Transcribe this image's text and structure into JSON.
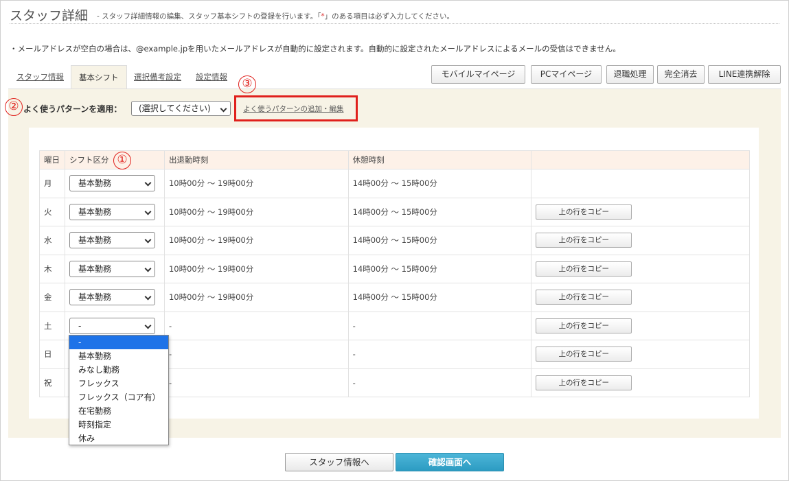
{
  "header": {
    "title": "スタッフ詳細",
    "subtitle_pre": "- スタッフ詳細情報の編集、スタッフ基本シフトの登録を行います。「",
    "subtitle_req": "*",
    "subtitle_post": "」のある項目は必ず入力してください。"
  },
  "notice": "・メールアドレスが空白の場合は、@example.jpを用いたメールアドレスが自動的に設定されます。自動的に設定されたメールアドレスによるメールの受信はできません。",
  "tabs": [
    {
      "label": "スタッフ情報",
      "active": false
    },
    {
      "label": "基本シフト",
      "active": true
    },
    {
      "label": "選択備考設定",
      "active": false
    },
    {
      "label": "設定情報",
      "active": false
    }
  ],
  "top_buttons": [
    "モバイルマイページ",
    "PCマイページ",
    "退職処理",
    "完全消去",
    "LINE連携解除"
  ],
  "pattern": {
    "label": "よく使うパターンを適用：",
    "selected": "(選択してください)",
    "edit_link": "よく使うパターンの追加・編集"
  },
  "markers": [
    "①",
    "②",
    "③"
  ],
  "table": {
    "headers": [
      "曜日",
      "シフト区分",
      "出退勤時刻",
      "休憩時刻",
      ""
    ],
    "rows": [
      {
        "day": "月",
        "shift": "基本勤務",
        "work": "10時00分 ～ 19時00分",
        "break": "14時00分 ～ 15時00分",
        "copy": ""
      },
      {
        "day": "火",
        "shift": "基本勤務",
        "work": "10時00分 ～ 19時00分",
        "break": "14時00分 ～ 15時00分",
        "copy": "上の行をコピー"
      },
      {
        "day": "水",
        "shift": "基本勤務",
        "work": "10時00分 ～ 19時00分",
        "break": "14時00分 ～ 15時00分",
        "copy": "上の行をコピー"
      },
      {
        "day": "木",
        "shift": "基本勤務",
        "work": "10時00分 ～ 19時00分",
        "break": "14時00分 ～ 15時00分",
        "copy": "上の行をコピー"
      },
      {
        "day": "金",
        "shift": "基本勤務",
        "work": "10時00分 ～ 19時00分",
        "break": "14時00分 ～ 15時00分",
        "copy": "上の行をコピー"
      },
      {
        "day": "土",
        "shift": "-",
        "work": "-",
        "break": "-",
        "copy": "上の行をコピー"
      },
      {
        "day": "日",
        "shift": "",
        "work": "-",
        "break": "-",
        "copy": "上の行をコピー"
      },
      {
        "day": "祝",
        "shift": "",
        "work": "-",
        "break": "-",
        "copy": "上の行をコピー"
      }
    ]
  },
  "dropdown_options": [
    "-",
    "基本勤務",
    "みなし勤務",
    "フレックス",
    "フレックス（コア有）",
    "在宅勤務",
    "時刻指定",
    "休み"
  ],
  "dropdown_selected": "-",
  "footer": {
    "back_label": "スタッフ情報へ",
    "confirm_label": "確認画面へ"
  },
  "colors": {
    "accent_red": "#e0201c",
    "panel_bg": "#f7f3e6",
    "header_bg": "#fdf1e8",
    "confirm_btn": "#2c9bc2",
    "dropdown_highlight": "#1e73e8"
  }
}
